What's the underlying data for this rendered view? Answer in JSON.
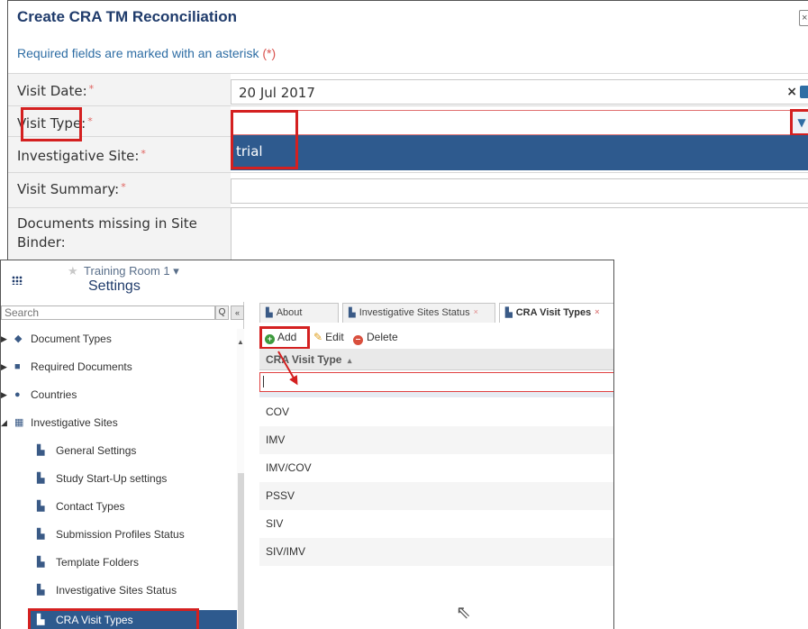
{
  "form": {
    "title": "Create CRA TM Reconciliation",
    "close_icon": "×",
    "required_note": "Required fields are marked with an asterisk",
    "required_star": "(*)",
    "fields": {
      "visit_date": {
        "label": "Visit Date:",
        "value": "20 Jul 2017"
      },
      "visit_type": {
        "label": "Visit Type:",
        "value": ""
      },
      "investigative_site": {
        "label": "Investigative Site:"
      },
      "visit_summary": {
        "label": "Visit Summary:"
      },
      "documents_missing": {
        "label": "Documents missing in Site Binder:"
      }
    },
    "asterisk": "*",
    "dropdown_option": "trial"
  },
  "settings": {
    "room": "Training Room 1",
    "room_caret": "▾",
    "title": "Settings",
    "search_placeholder": "Search",
    "tree": [
      {
        "label": "Document Types",
        "icon": "tag-icon"
      },
      {
        "label": "Required Documents",
        "icon": "clipboard-icon"
      },
      {
        "label": "Countries",
        "icon": "globe-icon"
      },
      {
        "label": "Investigative Sites",
        "icon": "sites-icon"
      },
      {
        "label": "General Settings",
        "icon": "doc-icon"
      },
      {
        "label": "Study Start-Up settings",
        "icon": "doc-icon"
      },
      {
        "label": "Contact Types",
        "icon": "doc-icon"
      },
      {
        "label": "Submission Profiles Status",
        "icon": "doc-icon"
      },
      {
        "label": "Template Folders",
        "icon": "doc-icon"
      },
      {
        "label": "Investigative Sites Status",
        "icon": "doc-icon"
      },
      {
        "label": "CRA Visit Types",
        "icon": "doc-icon"
      }
    ],
    "tabs": [
      {
        "label": "About"
      },
      {
        "label": "Investigative Sites Status"
      },
      {
        "label": "CRA Visit Types"
      }
    ],
    "toolbar": {
      "add": "Add",
      "edit": "Edit",
      "delete": "Delete"
    },
    "grid": {
      "header": "CRA Visit Type",
      "sort_icon": "▴",
      "rows": [
        "COV",
        "IMV",
        "IMV/COV",
        "PSSV",
        "SIV",
        "SIV/IMV"
      ]
    }
  }
}
